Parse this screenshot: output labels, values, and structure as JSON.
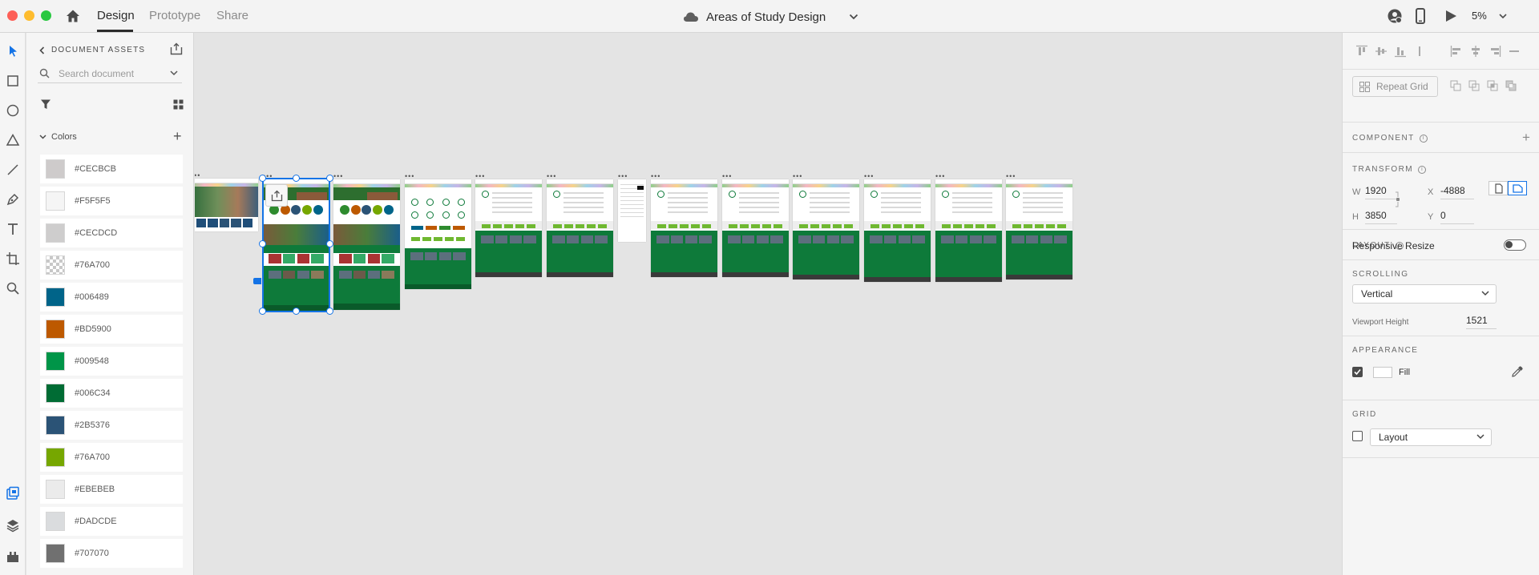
{
  "titlebar": {
    "tabs": [
      {
        "label": "Design",
        "active": true
      },
      {
        "label": "Prototype",
        "active": false
      },
      {
        "label": "Share",
        "active": false
      }
    ],
    "document_title": "Areas of Study Design",
    "zoom": "5%"
  },
  "tools": [
    "select-tool",
    "rectangle-tool",
    "ellipse-tool",
    "polygon-tool",
    "line-tool",
    "pen-tool",
    "text-tool",
    "artboard-tool",
    "zoom-tool"
  ],
  "assets": {
    "header": "DOCUMENT ASSETS",
    "search_placeholder": "Search document",
    "colors_label": "Colors",
    "colors": [
      {
        "label": "#CECBCB",
        "hex": "#CECBCB"
      },
      {
        "label": "#F5F5F5",
        "hex": "#F5F5F5"
      },
      {
        "label": "#CECDCD",
        "hex": "#CECDCD"
      },
      {
        "label": "#76A700",
        "hex": "checker"
      },
      {
        "label": "#006489",
        "hex": "#006489"
      },
      {
        "label": "#BD5900",
        "hex": "#BD5900"
      },
      {
        "label": "#009548",
        "hex": "#009548"
      },
      {
        "label": "#006C34",
        "hex": "#006C34"
      },
      {
        "label": "#2B5376",
        "hex": "#2B5376"
      },
      {
        "label": "#76A700",
        "hex": "#76A700"
      },
      {
        "label": "#EBEBEB",
        "hex": "#EBEBEB"
      },
      {
        "label": "#DADCDE",
        "hex": "#DADCDE"
      },
      {
        "label": "#707070",
        "hex": "#707070"
      }
    ]
  },
  "properties": {
    "repeat_grid": "Repeat Grid",
    "component": "COMPONENT",
    "transform": "TRANSFORM",
    "w_label": "W",
    "w_value": "1920",
    "x_label": "X",
    "x_value": "-4888",
    "h_label": "H",
    "h_value": "3850",
    "y_label": "Y",
    "y_value": "0",
    "layout": "LAYOUT",
    "responsive_resize": "Responsive Resize",
    "responsive_resize_on": false,
    "scrolling": "SCROLLING",
    "scrolling_value": "Vertical",
    "viewport_height_label": "Viewport Height",
    "viewport_height_value": "1521",
    "appearance": "APPEARANCE",
    "fill_label": "Fill",
    "fill_checked": true,
    "grid": "GRID",
    "grid_checked": false,
    "grid_value": "Layout"
  },
  "colors": {
    "accent": "#1473E6",
    "site_green": "#0E7A3A",
    "site_lime": "#6FB830"
  }
}
